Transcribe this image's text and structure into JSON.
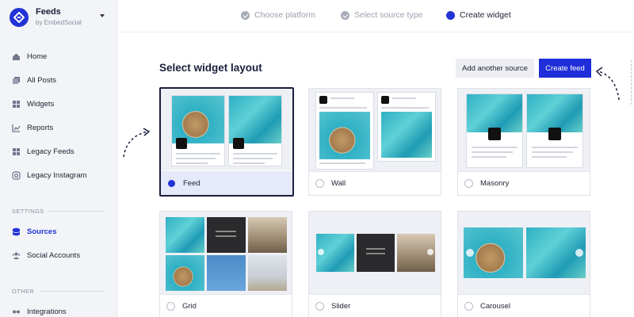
{
  "brand": {
    "title": "Feeds",
    "subtitle": "by EmbedSocial"
  },
  "sidebar": {
    "items": [
      {
        "label": "Home",
        "icon": "home-icon"
      },
      {
        "label": "All Posts",
        "icon": "posts-icon"
      },
      {
        "label": "Widgets",
        "icon": "widgets-icon"
      },
      {
        "label": "Reports",
        "icon": "reports-icon"
      },
      {
        "label": "Legacy Feeds",
        "icon": "legacy-feeds-icon"
      },
      {
        "label": "Legacy Instagram",
        "icon": "instagram-icon"
      }
    ],
    "settings_label": "SETTINGS",
    "settings_items": [
      {
        "label": "Sources",
        "icon": "database-icon",
        "active": true
      },
      {
        "label": "Social Accounts",
        "icon": "users-icon"
      }
    ],
    "other_label": "OTHER",
    "other_items": [
      {
        "label": "Integrations",
        "icon": "integrations-icon"
      }
    ]
  },
  "steps": [
    {
      "label": "Choose platform",
      "status": "done"
    },
    {
      "label": "Select source type",
      "status": "done"
    },
    {
      "label": "Create widget",
      "status": "current"
    }
  ],
  "main": {
    "title": "Select widget layout",
    "add_source_label": "Add another source",
    "create_feed_label": "Create feed",
    "layouts": [
      {
        "label": "Feed",
        "selected": true
      },
      {
        "label": "Wall",
        "selected": false
      },
      {
        "label": "Masonry",
        "selected": false
      },
      {
        "label": "Grid",
        "selected": false
      },
      {
        "label": "Slider",
        "selected": false
      },
      {
        "label": "Carousel",
        "selected": false
      }
    ]
  },
  "colors": {
    "accent": "#2233d6",
    "sidebar_bg": "#f3f4f7",
    "selected_bg": "#e6e9f9"
  }
}
